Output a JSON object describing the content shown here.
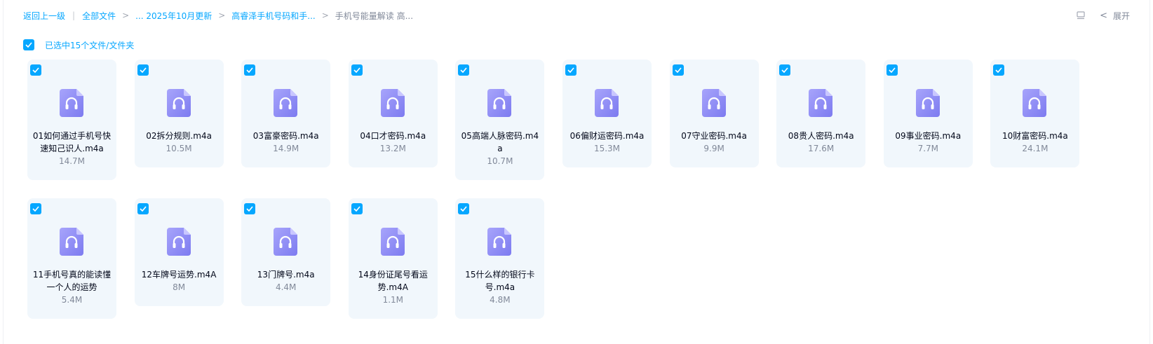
{
  "breadcrumb": {
    "back": "返回上一级",
    "root": "全部文件",
    "level1": "... 2025年10月更新",
    "level2": "高睿泽手机号码和手...",
    "current": "手机号能量解读 高..."
  },
  "toolbar": {
    "expand_label": "展开"
  },
  "selection": {
    "text": "已选中15个文件/文件夹"
  },
  "colors": {
    "accent": "#06a7ff",
    "card_bg": "#f1f7fc",
    "icon_purple": "#8e8cf5"
  },
  "files": [
    {
      "name": "01如何通过手机号快速知己识人.m4a",
      "size": "14.7M",
      "icon": "audio-file-icon"
    },
    {
      "name": "02拆分规则.m4a",
      "size": "10.5M",
      "icon": "audio-file-icon"
    },
    {
      "name": "03富豪密码.m4a",
      "size": "14.9M",
      "icon": "audio-file-icon"
    },
    {
      "name": "04口才密码.m4a",
      "size": "13.2M",
      "icon": "audio-file-icon"
    },
    {
      "name": "05高端人脉密码.m4a",
      "size": "10.7M",
      "icon": "audio-file-icon"
    },
    {
      "name": "06偏财运密码.m4a",
      "size": "15.3M",
      "icon": "audio-file-icon"
    },
    {
      "name": "07守业密码.m4a",
      "size": "9.9M",
      "icon": "audio-file-icon"
    },
    {
      "name": "08贵人密码.m4a",
      "size": "17.6M",
      "icon": "audio-file-icon"
    },
    {
      "name": "09事业密码.m4a",
      "size": "7.7M",
      "icon": "audio-file-icon"
    },
    {
      "name": "10财富密码.m4a",
      "size": "24.1M",
      "icon": "audio-file-icon"
    },
    {
      "name": "11手机号真的能读懂一个人的运势",
      "size": "5.4M",
      "icon": "audio-file-icon"
    },
    {
      "name": "12车牌号运势.m4A",
      "size": "8M",
      "icon": "audio-file-icon"
    },
    {
      "name": "13门牌号.m4a",
      "size": "4.4M",
      "icon": "audio-file-icon"
    },
    {
      "name": "14身份证尾号看运势.m4A",
      "size": "1.1M",
      "icon": "audio-file-icon"
    },
    {
      "name": "15什么样的银行卡号.m4a",
      "size": "4.8M",
      "icon": "audio-file-icon"
    }
  ]
}
